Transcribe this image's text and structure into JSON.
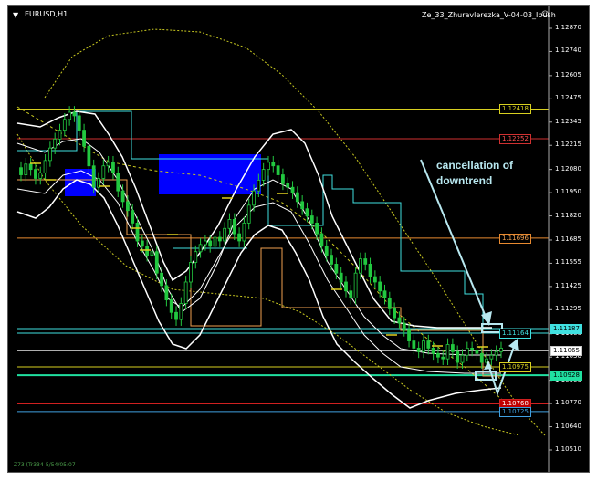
{
  "window": {
    "symbol_label": "EURUSD,H1",
    "indicator_label": "Ze_33_Zhuravlerezka_V-04-03_Ibush",
    "smiley_icon": "smiley-icon",
    "footer_text": "Z73 (Tr334-5/54/05:07"
  },
  "annotation": {
    "text_line1": "cancellation of",
    "text_line2": "downtrend"
  },
  "colors": {
    "background": "#000000",
    "candles": "#22c840",
    "white_band": "#ffffff",
    "blue_box": "#0000ff",
    "cyan_line": "#40e0e0",
    "orange_line": "#f0a050",
    "yellow_band": "#c8c820",
    "annotation_text": "#b8e8f0"
  },
  "chart_data": {
    "type": "candlestick",
    "symbol": "EURUSD",
    "timeframe": "H1",
    "y_axis_ticks": [
      "1.12870",
      "1.12740",
      "1.12605",
      "1.12475",
      "1.12345",
      "1.12215",
      "1.12080",
      "1.11950",
      "1.11820",
      "1.11685",
      "1.11555",
      "1.11425",
      "1.11295",
      "1.11160",
      "1.11030",
      "1.10900",
      "1.10770",
      "1.10640",
      "1.10510"
    ],
    "ylim": [
      1.104,
      1.129
    ],
    "price_lines": [
      {
        "label": "1.12418",
        "value": 1.12418,
        "color": "#d8d020",
        "box_fill": "#000000",
        "text_color": "#d8d020"
      },
      {
        "label": "1.12252",
        "value": 1.12252,
        "color": "#d03030",
        "box_fill": "#000000",
        "text_color": "#ff5050"
      },
      {
        "label": "1.11696",
        "value": 1.11696,
        "color": "#e88a30",
        "box_fill": "#000000",
        "text_color": "#f0a050"
      },
      {
        "label": "1.11187",
        "value": 1.11187,
        "color": "#40e0e0",
        "box_fill": "#40e0e0",
        "text_color": "#000000"
      },
      {
        "label": "1.11164",
        "value": 1.11164,
        "color": "#40e0e0",
        "box_fill": "#000000",
        "text_color": "#40e0e0"
      },
      {
        "label": "1.11065",
        "value": 1.11065,
        "color": "#c8c8c8",
        "box_fill": "#ffffff",
        "text_color": "#000000"
      },
      {
        "label": "1.10975",
        "value": 1.10975,
        "color": "#d8d020",
        "box_fill": "#000000",
        "text_color": "#d8d020"
      },
      {
        "label": "1.10928",
        "value": 1.10928,
        "color": "#20e0a0",
        "box_fill": "#20e0a0",
        "text_color": "#000000"
      },
      {
        "label": "1.10768",
        "value": 1.10768,
        "color": "#d02020",
        "box_fill": "#c00000",
        "text_color": "#ffffff"
      },
      {
        "label": "1.10725",
        "value": 1.10725,
        "color": "#40a0e0",
        "box_fill": "#000000",
        "text_color": "#40a0e0"
      }
    ],
    "candles_close": [
      1.1205,
      1.1211,
      1.1208,
      1.1203,
      1.1206,
      1.1213,
      1.122,
      1.1225,
      1.123,
      1.1236,
      1.124,
      1.1238,
      1.123,
      1.1221,
      1.121,
      1.1198,
      1.1203,
      1.121,
      1.1212,
      1.1206,
      1.1196,
      1.119,
      1.1185,
      1.1178,
      1.1168,
      1.1165,
      1.116,
      1.1162,
      1.115,
      1.1143,
      1.1135,
      1.1128,
      1.1124,
      1.1133,
      1.1145,
      1.1156,
      1.1162,
      1.1166,
      1.1168,
      1.1165,
      1.117,
      1.1168,
      1.1175,
      1.118,
      1.1172,
      1.1168,
      1.1178,
      1.1188,
      1.1196,
      1.1202,
      1.1208,
      1.1212,
      1.121,
      1.1205,
      1.12,
      1.1198,
      1.1195,
      1.119,
      1.1186,
      1.1182,
      1.1178,
      1.1172,
      1.1165,
      1.116,
      1.1155,
      1.115,
      1.1145,
      1.114,
      1.1136,
      1.115,
      1.1158,
      1.1155,
      1.1148,
      1.1145,
      1.114,
      1.1136,
      1.113,
      1.1125,
      1.1122,
      1.1118,
      1.1112,
      1.1108,
      1.1106,
      1.1112,
      1.1108,
      1.1105,
      1.1103,
      1.1102,
      1.111,
      1.1106,
      1.11,
      1.1104,
      1.1108,
      1.1107,
      1.1105,
      1.11,
      1.1102,
      1.1104,
      1.1106,
      1.1108
    ]
  }
}
